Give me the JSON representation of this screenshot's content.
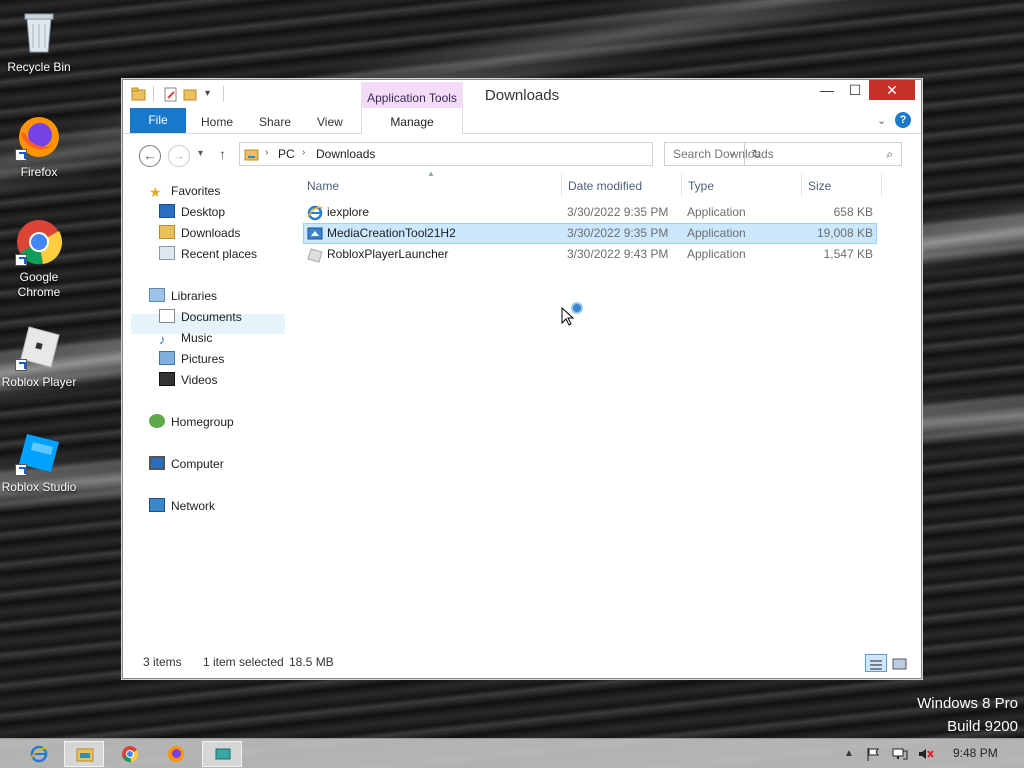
{
  "desktop": {
    "icons": [
      {
        "label": "Recycle Bin",
        "icon": "recycle-bin-icon"
      },
      {
        "label": "Firefox",
        "icon": "firefox-icon"
      },
      {
        "label": "Google Chrome",
        "icon": "chrome-icon"
      },
      {
        "label": "Roblox Player",
        "icon": "roblox-player-icon"
      },
      {
        "label": "Roblox Studio",
        "icon": "roblox-studio-icon"
      }
    ],
    "watermark": {
      "line1": "Windows 8 Pro",
      "line2": "Build 9200"
    }
  },
  "window": {
    "title": "Downloads",
    "context_tab_group": "Application Tools",
    "ribbon_tabs": {
      "file": "File",
      "home": "Home",
      "share": "Share",
      "view": "View",
      "manage": "Manage"
    },
    "address": {
      "root": "PC",
      "current": "Downloads"
    },
    "search_placeholder": "Search Downloads",
    "nav": {
      "favorites": {
        "label": "Favorites",
        "items": [
          "Desktop",
          "Downloads",
          "Recent places"
        ]
      },
      "libraries": {
        "label": "Libraries",
        "items": [
          "Documents",
          "Music",
          "Pictures",
          "Videos"
        ]
      },
      "homegroup": "Homegroup",
      "computer": "Computer",
      "network": "Network"
    },
    "columns": {
      "name": "Name",
      "date": "Date modified",
      "type": "Type",
      "size": "Size"
    },
    "files": [
      {
        "name": "iexplore",
        "date": "3/30/2022 9:35 PM",
        "type": "Application",
        "size": "658 KB",
        "icon": "internet-explorer-icon",
        "selected": false
      },
      {
        "name": "MediaCreationTool21H2",
        "date": "3/30/2022 9:35 PM",
        "type": "Application",
        "size": "19,008 KB",
        "icon": "media-creation-tool-icon",
        "selected": true
      },
      {
        "name": "RobloxPlayerLauncher",
        "date": "3/30/2022 9:43 PM",
        "type": "Application",
        "size": "1,547 KB",
        "icon": "roblox-launcher-icon",
        "selected": false
      }
    ],
    "status": {
      "count": "3 items",
      "selected": "1 item selected",
      "size": "18.5 MB"
    }
  },
  "taskbar": {
    "clock": "9:48 PM"
  },
  "colors": {
    "accent": "#1979ca",
    "selection": "#cce8ff",
    "close": "#c7312a",
    "app_tools": "#f3dcf5"
  }
}
